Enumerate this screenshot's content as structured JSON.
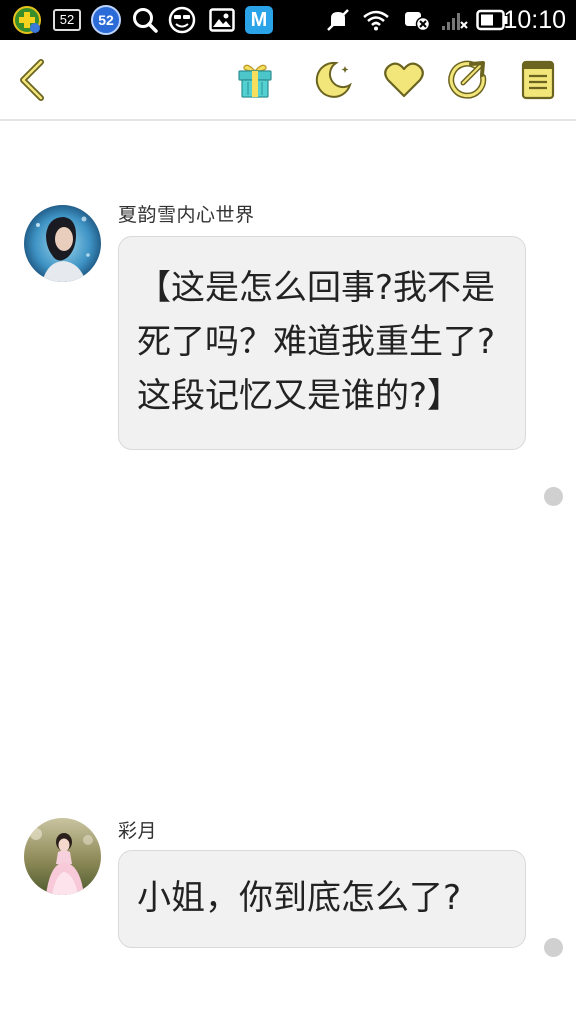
{
  "status_bar": {
    "time": "10:10",
    "badge_a": "52",
    "badge_b": "52",
    "app_icons": [
      "app-plus-icon",
      "notification-52-icon",
      "circle-52-icon",
      "search-icon",
      "emoji-icon",
      "image-icon",
      "m-app-icon"
    ],
    "system_icons": [
      "silent-icon",
      "wifi-icon",
      "sim-off-icon",
      "signal-icon",
      "battery-icon"
    ]
  },
  "toolbar": {
    "icons": [
      "back-icon",
      "gift-icon",
      "night-mode-icon",
      "heart-icon",
      "share-icon",
      "notes-icon"
    ]
  },
  "messages": [
    {
      "sender": "夏韵雪内心世界",
      "text": "【这是怎么回事?我不是死了吗？难道我重生了?这段记忆又是谁的?】",
      "avatar": "avatar-xia-yunxue"
    },
    {
      "sender": "彩月",
      "text": "小姐，你到底怎么了?",
      "avatar": "avatar-caiyue"
    }
  ],
  "colors": {
    "accent_yellow": "#f2e57a",
    "icon_outline": "#6b6320",
    "bubble_bg": "#f1f1f1",
    "gift_teal": "#4cc6c9"
  }
}
